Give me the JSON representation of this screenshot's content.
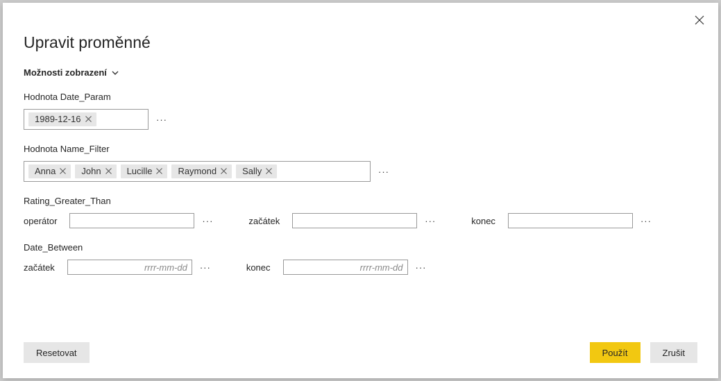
{
  "dialog": {
    "title": "Upravit proměnné",
    "display_options_label": "Možnosti zobrazení"
  },
  "fields": {
    "date_param": {
      "label": "Hodnota Date_Param",
      "tokens": [
        "1989-12-16"
      ]
    },
    "name_filter": {
      "label": "Hodnota Name_Filter",
      "tokens": [
        "Anna",
        "John",
        "Lucille",
        "Raymond",
        "Sally"
      ]
    },
    "rating_greater_than": {
      "label": "Rating_Greater_Than",
      "operator_label": "operátor",
      "operator_value": "",
      "start_label": "začátek",
      "start_value": "",
      "end_label": "konec",
      "end_value": ""
    },
    "date_between": {
      "label": "Date_Between",
      "start_label": "začátek",
      "start_value": "",
      "start_placeholder": "rrrr-mm-dd",
      "end_label": "konec",
      "end_value": "",
      "end_placeholder": "rrrr-mm-dd"
    }
  },
  "buttons": {
    "reset": "Resetovat",
    "apply": "Použít",
    "cancel": "Zrušit"
  }
}
